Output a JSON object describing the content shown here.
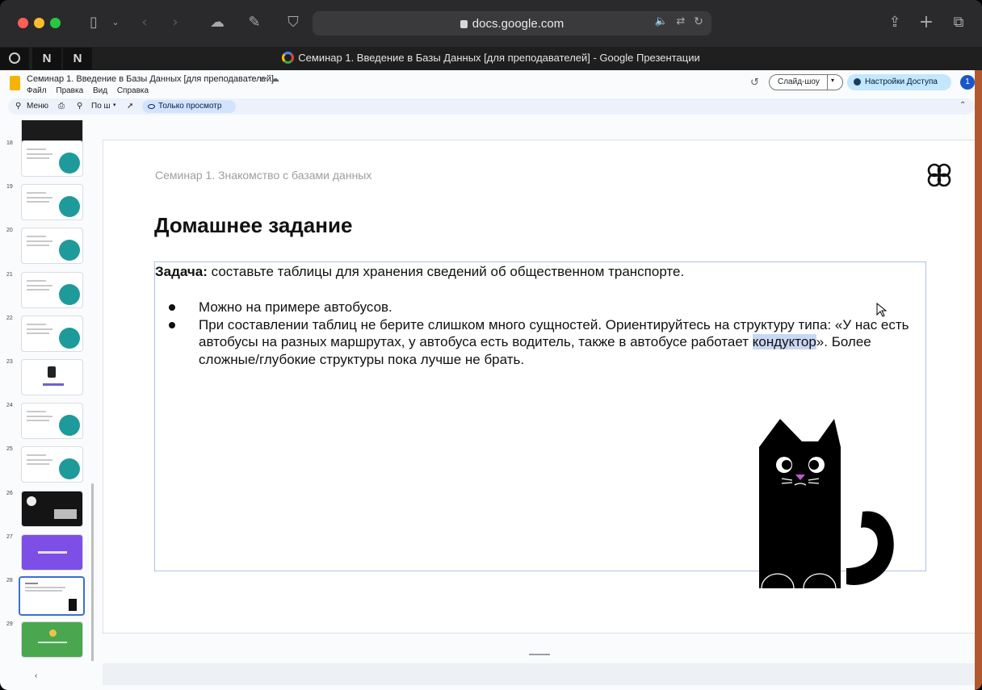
{
  "browser": {
    "url": "docs.google.com",
    "tab_title": "Семинар 1. Введение в Базы Данных [для преподавателей] - Google Презентации",
    "pinned_tabs": [
      "",
      "N",
      "N"
    ]
  },
  "docs": {
    "title": "Семинар 1. Введение в Базы Данных [для преподавателей]",
    "menu": [
      "Файл",
      "Правка",
      "Вид",
      "Справка"
    ],
    "slideshow_label": "Слайд-шоу",
    "share_label": "Настройки Доступа",
    "avatar_count": "1",
    "toolbar": {
      "menu_label": "Меню",
      "zoom_label": "По ш",
      "view_only_label": "Только просмотр"
    }
  },
  "filmstrip": {
    "numbers": [
      "18",
      "19",
      "20",
      "21",
      "22",
      "23",
      "24",
      "25",
      "26",
      "27",
      "28",
      "29"
    ],
    "selected": "28"
  },
  "slide": {
    "subtitle": "Семинар 1. Знакомство с базами данных",
    "heading": "Домашнее задание",
    "task_label": "Задача:",
    "task_text": " составьте таблицы для хранения сведений об общественном транспорте.",
    "bullet1": "Можно на примере автобусов.",
    "bullet2_a": "При составлении таблиц не берите слишком много сущностей. Ориентируйтесь на структуру типа: «У нас есть автобусы на разных маршрутах, у автобуса есть водитель, также в автобусе работает ",
    "bullet2_hl": "кондуктор",
    "bullet2_b": "». Более сложные/глубокие структуры пока лучше не брать."
  },
  "colors": {
    "accent_teal": "#1e9a9a",
    "share_bg": "#c2e7ff",
    "highlight": "#c8d7f3"
  }
}
